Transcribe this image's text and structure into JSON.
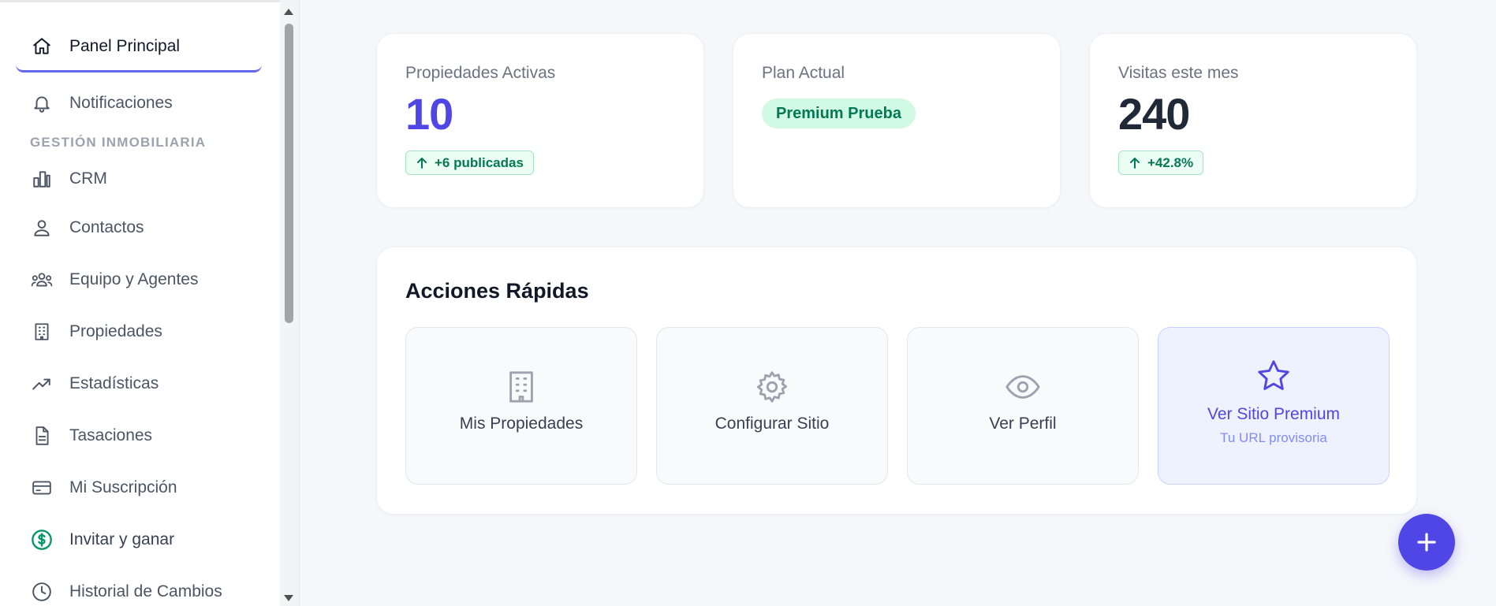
{
  "sidebar": {
    "items": [
      {
        "label": "Panel Principal",
        "icon": "home-icon"
      },
      {
        "label": "Notificaciones",
        "icon": "bell-icon"
      },
      {
        "label": "CRM",
        "icon": "building-chart-icon"
      },
      {
        "label": "Contactos",
        "icon": "user-icon"
      },
      {
        "label": "Equipo y Agentes",
        "icon": "users-icon"
      },
      {
        "label": "Propiedades",
        "icon": "building-icon"
      },
      {
        "label": "Estadísticas",
        "icon": "trending-up-icon"
      },
      {
        "label": "Tasaciones",
        "icon": "document-icon"
      },
      {
        "label": "Mi Suscripción",
        "icon": "credit-card-icon"
      },
      {
        "label": "Invitar y ganar",
        "icon": "dollar-circle-icon"
      },
      {
        "label": "Historial de Cambios",
        "icon": "clock-icon"
      }
    ],
    "section_label": "GESTIÓN INMOBILIARIA"
  },
  "stats": {
    "active": {
      "label": "Propiedades Activas",
      "value": "10",
      "trend": "+6 publicadas"
    },
    "plan": {
      "label": "Plan Actual",
      "badge": "Premium Prueba"
    },
    "visits": {
      "label": "Visitas este mes",
      "value": "240",
      "trend": "+42.8%"
    }
  },
  "actions": {
    "title": "Acciones Rápidas",
    "items": [
      {
        "label": "Mis Propiedades",
        "icon": "building-icon"
      },
      {
        "label": "Configurar Sitio",
        "icon": "gear-icon"
      },
      {
        "label": "Ver Perfil",
        "icon": "eye-icon"
      },
      {
        "label": "Ver Sitio Premium",
        "sublabel": "Tu URL provisoria",
        "icon": "star-icon"
      }
    ]
  },
  "colors": {
    "accent": "#4f46e5",
    "success": "#047857",
    "success_bg": "#d1fae5",
    "dollar_icon": "#059669"
  }
}
